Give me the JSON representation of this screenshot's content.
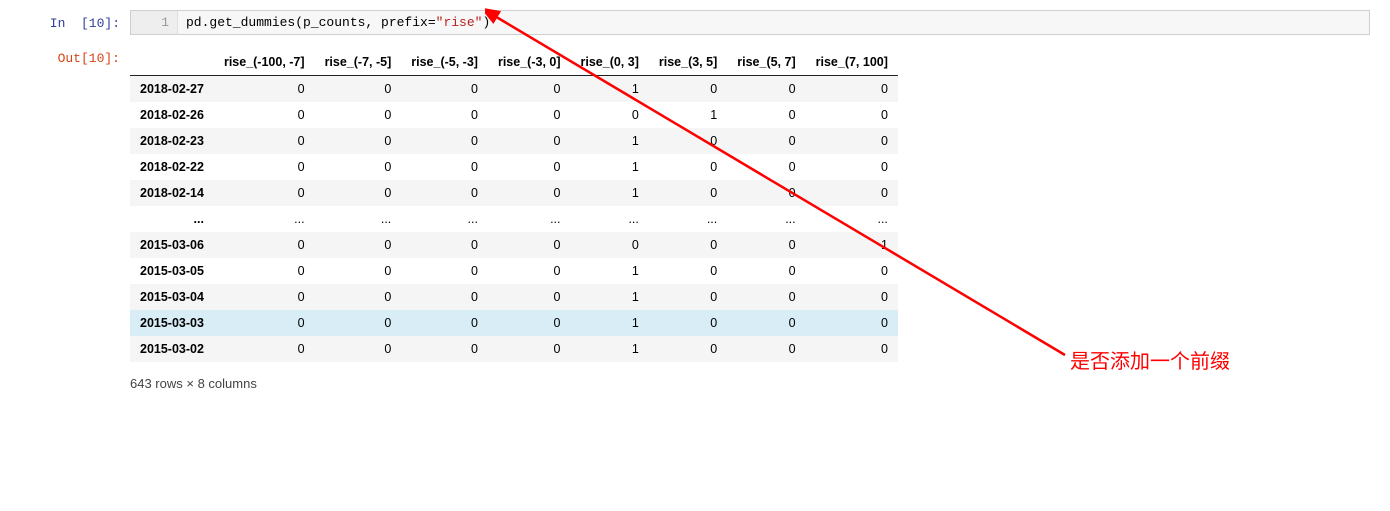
{
  "in_label": "In  [10]:",
  "out_label": "Out[10]:",
  "code_line_no": "1",
  "code_prefix": "pd.get_dummies(p_counts, prefix=",
  "code_str": "\"rise\"",
  "code_suffix": ")",
  "columns": [
    "rise_(-100, -7]",
    "rise_(-7, -5]",
    "rise_(-5, -3]",
    "rise_(-3, 0]",
    "rise_(0, 3]",
    "rise_(3, 5]",
    "rise_(5, 7]",
    "rise_(7, 100]"
  ],
  "rows": [
    {
      "idx": "2018-02-27",
      "v": [
        "0",
        "0",
        "0",
        "0",
        "1",
        "0",
        "0",
        "0"
      ]
    },
    {
      "idx": "2018-02-26",
      "v": [
        "0",
        "0",
        "0",
        "0",
        "0",
        "1",
        "0",
        "0"
      ]
    },
    {
      "idx": "2018-02-23",
      "v": [
        "0",
        "0",
        "0",
        "0",
        "1",
        "0",
        "0",
        "0"
      ]
    },
    {
      "idx": "2018-02-22",
      "v": [
        "0",
        "0",
        "0",
        "0",
        "1",
        "0",
        "0",
        "0"
      ]
    },
    {
      "idx": "2018-02-14",
      "v": [
        "0",
        "0",
        "0",
        "0",
        "1",
        "0",
        "0",
        "0"
      ]
    },
    {
      "idx": "...",
      "v": [
        "...",
        "...",
        "...",
        "...",
        "...",
        "...",
        "...",
        "..."
      ],
      "ellipsis": true
    },
    {
      "idx": "2015-03-06",
      "v": [
        "0",
        "0",
        "0",
        "0",
        "0",
        "0",
        "0",
        "1"
      ]
    },
    {
      "idx": "2015-03-05",
      "v": [
        "0",
        "0",
        "0",
        "0",
        "1",
        "0",
        "0",
        "0"
      ]
    },
    {
      "idx": "2015-03-04",
      "v": [
        "0",
        "0",
        "0",
        "0",
        "1",
        "0",
        "0",
        "0"
      ]
    },
    {
      "idx": "2015-03-03",
      "v": [
        "0",
        "0",
        "0",
        "0",
        "1",
        "0",
        "0",
        "0"
      ],
      "hover": true
    },
    {
      "idx": "2015-03-02",
      "v": [
        "0",
        "0",
        "0",
        "0",
        "1",
        "0",
        "0",
        "0"
      ]
    }
  ],
  "dim_note": "643 rows × 8 columns",
  "annotation_text": "是否添加一个前缀",
  "accent_red": "#ff0000"
}
